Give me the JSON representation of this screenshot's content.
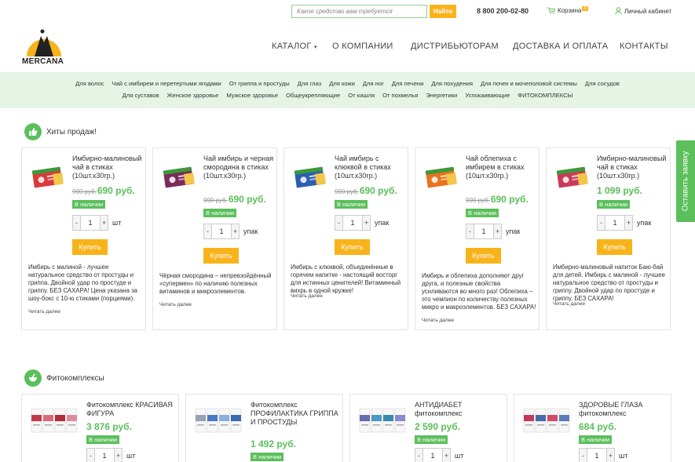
{
  "topbar": {
    "search_placeholder": "Какое средство вам требуется",
    "search_button": "Найти",
    "phone": "8 800 200-02-80",
    "cart_label": "Корзина",
    "cart_count": "0",
    "account_label": "Личный кабинет"
  },
  "logo": {
    "text": "MERCANA"
  },
  "nav": {
    "catalog": "КАТАЛОГ",
    "about": "О КОМПАНИИ",
    "distributors": "ДИСТРИБЬЮТОРАМ",
    "delivery": "ДОСТАВКА И ОПЛАТА",
    "contacts": "КОНТАКТЫ"
  },
  "categories_row1": [
    "Для волос",
    "Чай с имбирем и перетертыми ягодами",
    "От гриппа и простуды",
    "Для глаз",
    "Для кожи",
    "Для ног",
    "Для печени",
    "Для похудения",
    "Для почек и мочеполовой системы",
    "Для сосудов"
  ],
  "categories_row2": [
    "Для суставов",
    "Женское здоровье",
    "Мужское здоровье",
    "Общеукрепляющие",
    "От кашля",
    "От похмелья",
    "Энергетики",
    "Успокаивающие",
    "ФИТОКОМПЛЕКСЫ"
  ],
  "side_tab": "Оставить заявку",
  "hits": {
    "title": "Хиты продаж!",
    "products": [
      {
        "name": "Имбирно-малиновый чай в стиках (10шт.x30гр.)",
        "old_price": "990 руб.",
        "price": "690 руб.",
        "stock": "В наличии",
        "qty": "1",
        "unit": "шт",
        "buy": "Купить",
        "desc": "Имбирь с малиной - лучшее натуральное средство от простуды и гриппа. Двойной удар по простуде и гриппу. БЕЗ САХАРА! Цена указана за шоу-бокс с 10-ю стиками (порциями).",
        "more": "Читать далее",
        "color": "#d93a3a"
      },
      {
        "name": "Чай имбирь и черная смородина в стиках (10шт.x30гр.)",
        "old_price": "990 руб.",
        "price": "690 руб.",
        "stock": "В наличии",
        "qty": "1",
        "unit": "упак",
        "buy": "Купить",
        "desc": "Чёрная смородина – непревзойдённый «супермен» по наличию полезных витаминов и микроэлементов.",
        "more": "Читать далее",
        "color": "#7b2a5c"
      },
      {
        "name": "Чай имбирь с клюквой в стиках (10шт.x30гр.)",
        "old_price": "990 руб.",
        "price": "690 руб.",
        "stock": "В наличии",
        "qty": "1",
        "unit": "упак",
        "buy": "Купить",
        "desc": "Имбирь с клюквой, объединённые в горячем напитке - настоящий восторг для истинных ценителей! Витаминный вихрь в одной кружке!",
        "more": "Читать далее",
        "color": "#2c5fb0"
      },
      {
        "name": "Чай облепиха с имбирем в стиках (10шт.x30гр.)",
        "old_price": "990 руб.",
        "price": "690 руб.",
        "stock": "В наличии",
        "qty": "1",
        "unit": "упак",
        "buy": "Купить",
        "desc": "Имбирь и облепиха дополняют друг друга, и полезные свойства усиливаются во много раз! Облепиха – это чемпион по количеству полезных микро и макроэлементов. БЕЗ САХАРА!",
        "more": "Читать далее",
        "color": "#e8731e"
      },
      {
        "name": "Имбирно-малиновый чай в стиках (10шт.x30гр.)",
        "old_price": "",
        "price": "1 099 руб.",
        "stock": "В наличии",
        "qty": "1",
        "unit": "упак",
        "buy": "Купить",
        "desc": "Имбирно-малиновый напиток Баю-бай для детей. Имбирь с малиной - лучшее натуральное средство от простуды и гриппу. Двойной удар по простуде и гриппу. БЕЗ САХАРА!",
        "more": "Читать далее",
        "color": "#c93a5a"
      }
    ]
  },
  "phyto": {
    "title": "Фитокомплексы",
    "products": [
      {
        "name": "Фитокомплекс КРАСИВАЯ ФИГУРА",
        "price": "3 876 руб.",
        "stock": "В наличии",
        "qty": "1",
        "unit": "шт"
      },
      {
        "name": "Фитокомплекс ПРОФИЛАКТИКА ГРИППА И ПРОСТУДЫ",
        "price": "1 492 руб.",
        "stock": "В наличии",
        "qty": "1",
        "unit": "шт"
      },
      {
        "name": "АНТИДИАБЕТ фитокомплекс",
        "price": "2 590 руб.",
        "stock": "В наличии",
        "qty": "1",
        "unit": "шт"
      },
      {
        "name": "ЗДОРОВЫЕ ГЛАЗА фитокомплекс",
        "price": "684 руб.",
        "stock": "В наличии",
        "qty": "1",
        "unit": "шт"
      }
    ]
  },
  "colors": {
    "green": "#5bbf5b",
    "orange": "#f9b31a",
    "band": "#e5f4e4"
  }
}
